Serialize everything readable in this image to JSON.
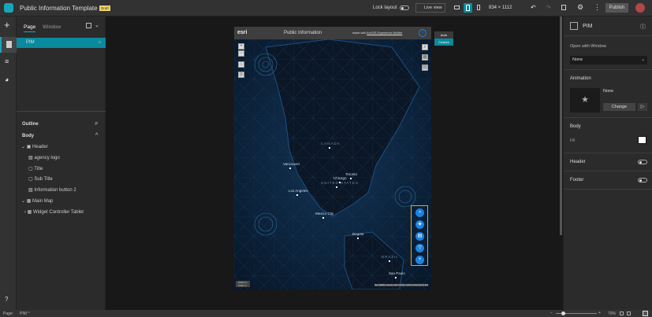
{
  "app": {
    "title": "Public Information Template 1",
    "badge": "Draft"
  },
  "toolbar": {
    "lock_layout": "Lock layout",
    "live_view": "Live view",
    "device_size": "834 × 1112",
    "publish": "Publish"
  },
  "left_panel": {
    "tabs": [
      "Page",
      "Window"
    ],
    "pages": [
      {
        "label": "PIM"
      }
    ],
    "outline": {
      "title": "Outline",
      "body": "Body",
      "items": [
        {
          "label": "Header",
          "level": 0,
          "expanded": true
        },
        {
          "label": "agency logo",
          "level": 1
        },
        {
          "label": "Title",
          "level": 1
        },
        {
          "label": "Sub Title",
          "level": 1
        },
        {
          "label": "Information button 2",
          "level": 1
        },
        {
          "label": "Main Map",
          "level": 0,
          "expanded": true
        },
        {
          "label": "Widget Controller Tablet",
          "level": 1,
          "expanded": false
        }
      ]
    }
  },
  "canvas": {
    "logo": "esri",
    "title": "Public Information",
    "made_with": "made with",
    "builder_link": "ArcGIS Experience Builder",
    "size_menu": [
      "Auto",
      "Custom"
    ],
    "map": {
      "countries": [
        "CANADA",
        "UNITED STATES",
        "BRAZIL"
      ],
      "cities": [
        "Vancouver",
        "Toronto",
        "Chicago",
        "Los Angeles",
        "Mexico City",
        "Bogota",
        "Sao Paulo"
      ],
      "scale": [
        "2000 km",
        "1000 mi"
      ],
      "attribution": "Esri, HERE, Garmin, FAO, NOAA, USGS | Powered by Esri"
    }
  },
  "right_panel": {
    "title": "PIM",
    "open_with_window": "Open with Window",
    "window_value": "None",
    "animation": "Animation",
    "animation_value": "None",
    "change": "Change",
    "body": "Body",
    "fill": "Fill",
    "header": "Header",
    "footer": "Footer",
    "fill_color": "#ffffff"
  },
  "bottom": {
    "page_label": "Page:",
    "page_value": "PIM",
    "zoom": "70%"
  },
  "colors": {
    "accent": "#0a8a9e",
    "widget_highlight": "#f5a300",
    "map_button": "#1a84e0"
  }
}
